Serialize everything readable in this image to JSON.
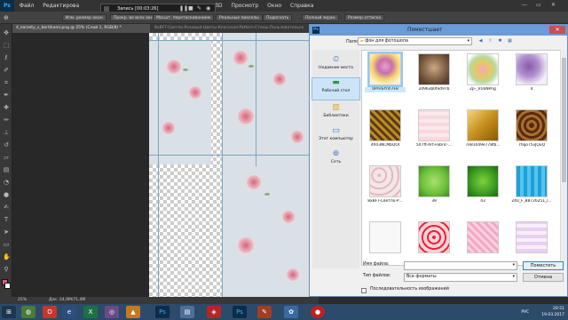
{
  "photoshop": {
    "logo": "Ps",
    "menu": [
      "Файл",
      "Редактирова",
      "3D",
      "Просмотр",
      "Окно",
      "Справка"
    ],
    "recording": "Запись [00:03:26]",
    "options": {
      "scroll_all": "Прокр. во всех окнах",
      "actual_pixels": "Реальные пикселы",
      "fit": "Подогнать",
      "full_screen": "Полный экран",
      "print_size": "Размер оттиска",
      "zoom_resize": "Изм. размер окон",
      "scrubby_zoom": "Масшт. перетаскиванием"
    },
    "tabs": [
      "4_korzety_s_bortikami.png @ 25% (Слой 1, RGB/8) *",
      "8xBFT-Светло-Розовый-Цветы-Классная-Pattern-Стены-Пользовательск"
    ],
    "status": {
      "zoom": "25%",
      "doc": "Док: 24,9M/71,4M"
    }
  },
  "dialog": {
    "title": "Поместшает",
    "ps_badge": "Ps",
    "folder_label": "Папка:",
    "folder_value": "фон для фотошопа",
    "places": [
      {
        "label": "Недавние места",
        "icon": "clock-folder-icon"
      },
      {
        "label": "Рабочий стол",
        "icon": "desktop-icon"
      },
      {
        "label": "Библиотеки",
        "icon": "library-icon"
      },
      {
        "label": "Этот компьютер",
        "icon": "computer-icon"
      },
      {
        "label": "Сеть",
        "icon": "network-icon"
      }
    ],
    "files": [
      {
        "name": "0PrHSYnh7F8",
        "thumb": "basket",
        "selected": true
      },
      {
        "name": "2d963b0fed97b",
        "thumb": "vintage"
      },
      {
        "name": "2p-_VUoNPng",
        "thumb": "flowers"
      },
      {
        "name": "4",
        "thumb": "purple"
      },
      {
        "name": "4h03NCMbQOI",
        "thumb": "ornate"
      },
      {
        "name": "5X7ft-Art-Fabric-...",
        "thumb": "pink-pattern"
      },
      {
        "name": "7e81049e778fb...",
        "thumb": "gold"
      },
      {
        "name": "7hqoT5vJQuQ",
        "thumb": "brown-ornate"
      },
      {
        "name": "8xBFT-Светло-Р...",
        "thumb": "light-floral"
      },
      {
        "name": "39",
        "thumb": "green"
      },
      {
        "name": "43",
        "thumb": "green-dark"
      },
      {
        "name": "240_F_88726251_l...",
        "thumb": "blue"
      },
      {
        "name": "",
        "thumb": "white"
      },
      {
        "name": "",
        "thumb": "red-hearts"
      },
      {
        "name": "",
        "thumb": "pink"
      },
      {
        "name": "",
        "thumb": "lilac"
      }
    ],
    "filename_label": "Имя файла:",
    "filename_value": "",
    "filetype_label": "Тип файлов:",
    "filetype_value": "Все форматы",
    "place_button": "Поместить",
    "cancel_button": "Отмена",
    "sequence_label": "Последовательность изображений"
  },
  "taskbar": {
    "lang": "РУС",
    "time": "20:51",
    "date": "19.03.2017"
  },
  "colors": {
    "ps_bg": "#2b2b2b",
    "dialog_title": "#6b9bd8",
    "taskbar": "#2c4a6a"
  }
}
